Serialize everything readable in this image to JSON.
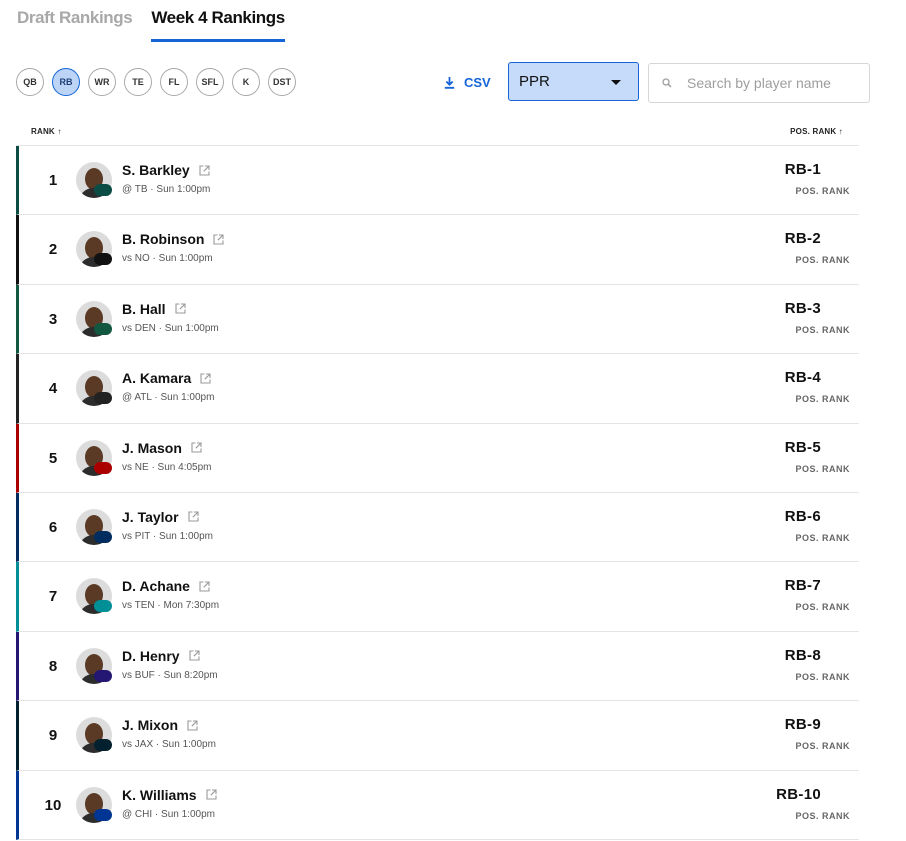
{
  "tabs": [
    {
      "label": "Draft Rankings",
      "active": false
    },
    {
      "label": "Week 4 Rankings",
      "active": true
    }
  ],
  "positions": [
    "QB",
    "RB",
    "WR",
    "TE",
    "FL",
    "SFL",
    "K",
    "DST"
  ],
  "selected_position": "RB",
  "export": {
    "label": "CSV",
    "icon": "download-icon"
  },
  "scoring_select": {
    "value": "PPR"
  },
  "search": {
    "placeholder": "Search by player name",
    "value": ""
  },
  "table": {
    "rank_header": "RANK ↑",
    "pos_rank_header": "POS. RANK ↑",
    "pos_rank_label": "POS. RANK",
    "rows": [
      {
        "rank": "1",
        "name": "S. Barkley",
        "game": "@ TB · Sun 1:00pm",
        "pos_rank": "RB-1",
        "team_color": "#0b4d45"
      },
      {
        "rank": "2",
        "name": "B. Robinson",
        "game": "vs NO · Sun 1:00pm",
        "pos_rank": "RB-2",
        "team_color": "#111111"
      },
      {
        "rank": "3",
        "name": "B. Hall",
        "game": "vs DEN · Sun 1:00pm",
        "pos_rank": "RB-3",
        "team_color": "#125740"
      },
      {
        "rank": "4",
        "name": "A. Kamara",
        "game": "@ ATL · Sun 1:00pm",
        "pos_rank": "RB-4",
        "team_color": "#222222"
      },
      {
        "rank": "5",
        "name": "J. Mason",
        "game": "vs NE · Sun 4:05pm",
        "pos_rank": "RB-5",
        "team_color": "#aa0000"
      },
      {
        "rank": "6",
        "name": "J. Taylor",
        "game": "vs PIT · Sun 1:00pm",
        "pos_rank": "RB-6",
        "team_color": "#002c5f"
      },
      {
        "rank": "7",
        "name": "D. Achane",
        "game": "vs TEN · Mon 7:30pm",
        "pos_rank": "RB-7",
        "team_color": "#008e97"
      },
      {
        "rank": "8",
        "name": "D. Henry",
        "game": "vs BUF · Sun 8:20pm",
        "pos_rank": "RB-8",
        "team_color": "#241773"
      },
      {
        "rank": "9",
        "name": "J. Mixon",
        "game": "vs JAX · Sun 1:00pm",
        "pos_rank": "RB-9",
        "team_color": "#03202f"
      },
      {
        "rank": "10",
        "name": "K. Williams",
        "game": "@ CHI · Sun 1:00pm",
        "pos_rank": "RB-10",
        "team_color": "#003594"
      }
    ]
  },
  "colors": {
    "accent": "#1565d8",
    "select_bg": "#c5dbf9",
    "selected_chip_bg": "#bcd4f6"
  }
}
